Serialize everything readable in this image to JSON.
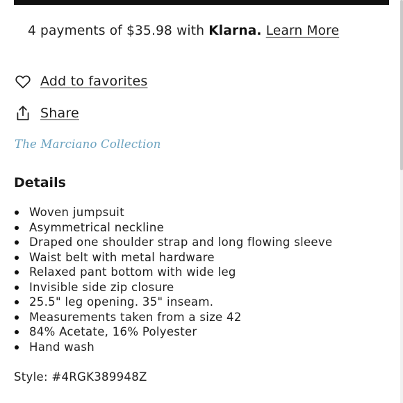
{
  "payment": {
    "prefix": "4 payments of $35.98 with",
    "brand": "Klarna.",
    "link": "Learn More"
  },
  "actions": {
    "favorites_label": "Add to favorites",
    "share_label": "Share"
  },
  "collection": "The Marciano Collection",
  "details": {
    "heading": "Details",
    "items": [
      "Woven jumpsuit",
      "Asymmetrical neckline",
      "Draped one shoulder strap and long flowing sleeve",
      "Waist belt with metal hardware",
      "Relaxed pant bottom with wide leg",
      "Invisible side zip closure",
      "25.5\" leg opening. 35\" inseam.",
      "Measurements taken from a size 42",
      "84% Acetate, 16% Polyester",
      "Hand wash"
    ]
  },
  "style": "Style: #4RGK389948Z",
  "colors": {
    "collection_link": "#6aa2bf",
    "text": "#1f1f1f"
  },
  "icons": [
    "heart-icon",
    "share-icon"
  ]
}
